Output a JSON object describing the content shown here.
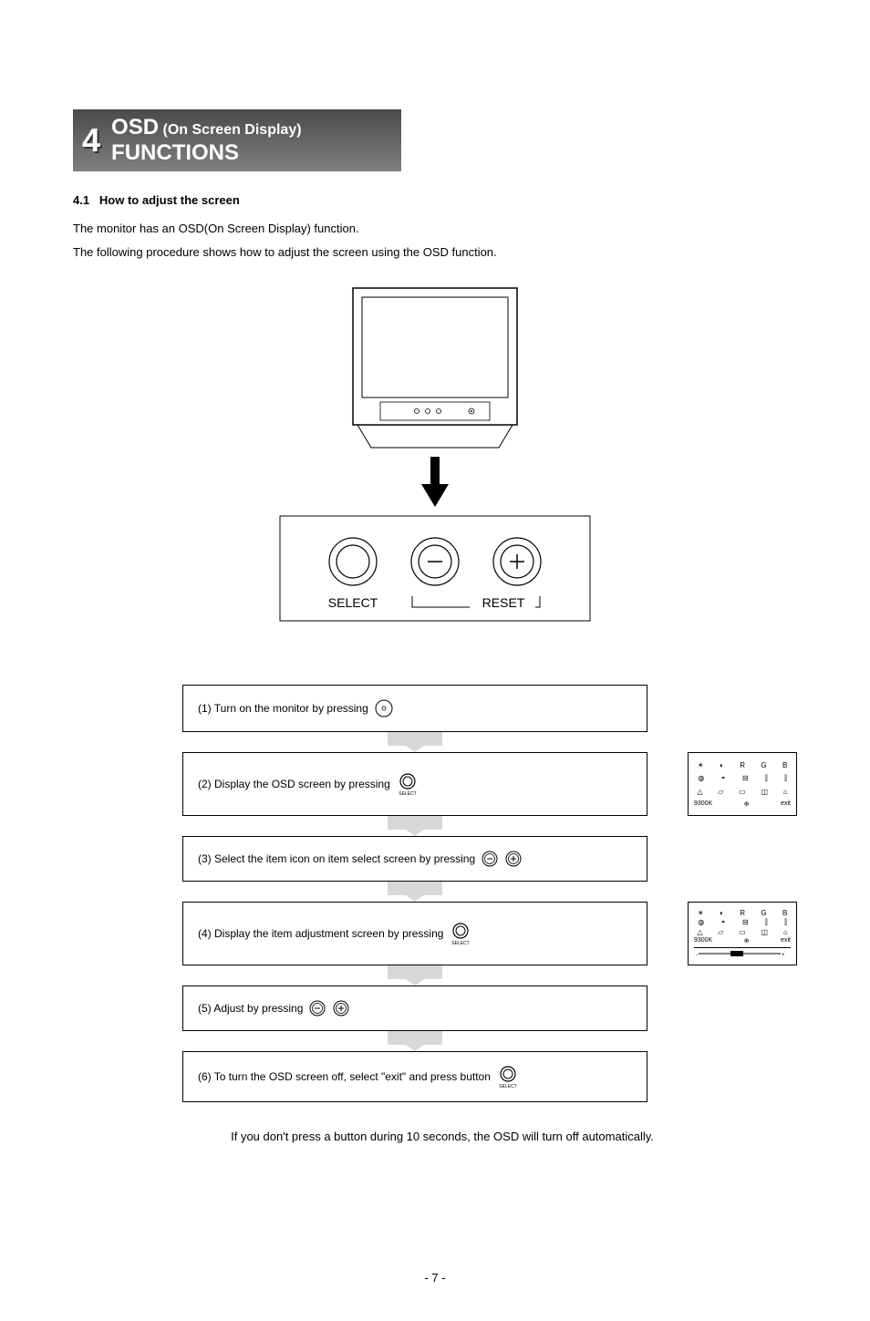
{
  "header": {
    "chapter_number": "4",
    "title_osd": "OSD",
    "title_sub": "(On Screen Display)",
    "title_functions": "FUNCTIONS"
  },
  "section": {
    "number": "4.1",
    "title": "How to adjust the screen"
  },
  "intro": {
    "line1": "The monitor has an OSD(On Screen Display) function.",
    "line2": "The following procedure shows how to adjust the screen using the OSD function."
  },
  "panel": {
    "select": "SELECT",
    "reset": "RESET"
  },
  "steps": {
    "s1": "(1) Turn on the monitor by pressing",
    "s2": "(2) Display the OSD screen by pressing",
    "s3": "(3) Select the item icon on item select screen by pressing",
    "s4": "(4) Display the item adjustment screen by pressing",
    "s5": "(5) Adjust by pressing",
    "s6": "(6) To turn the OSD screen off, select \"exit\" and press button"
  },
  "osd_preview": {
    "row1": [
      "☀",
      "◐",
      "R",
      "G",
      "B"
    ],
    "row2": [
      "◍",
      "◓",
      "⊟",
      "⫿",
      "⫿"
    ],
    "row3": [
      "△",
      "▱",
      "▭",
      "◫",
      "⌂"
    ],
    "bottom_left": "9300K",
    "bottom_right": "exit"
  },
  "footer_note": "If you don't press a button during 10 seconds, the OSD will turn off automatically.",
  "page_number": "- 7 -",
  "icon_labels": {
    "select_small": "SELECT"
  }
}
